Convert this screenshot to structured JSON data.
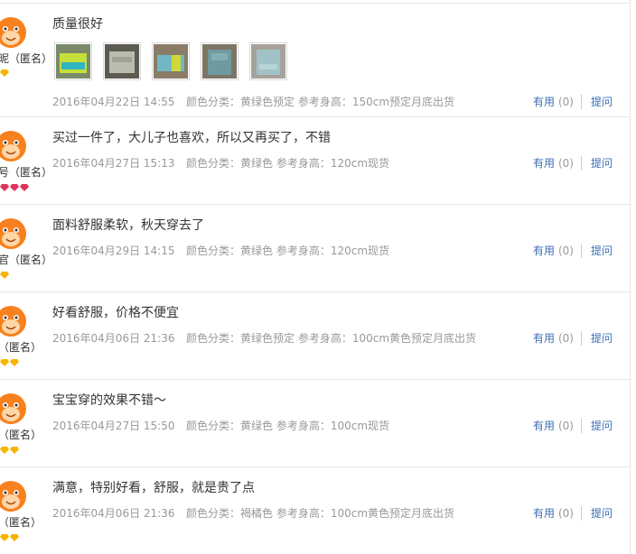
{
  "reviews": [
    {
      "user": "昵（匿名）",
      "gems": 1,
      "gem_color": "#f5b400",
      "content": "质量很好",
      "has_photos": true,
      "photos": [
        {
          "icon": "jacket-photo-icon"
        },
        {
          "icon": "pants-gray-photo-icon"
        },
        {
          "icon": "jacket-folded-photo-icon"
        },
        {
          "icon": "pants-photo-icon"
        },
        {
          "icon": "pants-light-photo-icon"
        }
      ],
      "date": "2016年04月22日 14:55",
      "sku": "颜色分类：黄绿色预定   参考身高：150cm预定月底出货",
      "useful_label": "有用",
      "useful_count": "(0)",
      "ask_label": "提问"
    },
    {
      "user": "号（匿名）",
      "gems": 3,
      "gem_color": "#e0325a",
      "content": "买过一件了，大儿子也喜欢，所以又再买了，不错",
      "has_photos": false,
      "date": "2016年04月27日 15:13",
      "sku": "颜色分类：黄绿色   参考身高：120cm现货",
      "useful_label": "有用",
      "useful_count": "(0)",
      "ask_label": "提问"
    },
    {
      "user": "官（匿名）",
      "gems": 1,
      "gem_color": "#f5b400",
      "content": "面料舒服柔软，秋天穿去了",
      "has_photos": false,
      "date": "2016年04月29日 14:15",
      "sku": "颜色分类：黄绿色   参考身高：120cm现货",
      "useful_label": "有用",
      "useful_count": "(0)",
      "ask_label": "提问"
    },
    {
      "user": "（匿名）",
      "gems": 2,
      "gem_color": "#f5b400",
      "content": "好看舒服，价格不便宜",
      "has_photos": false,
      "date": "2016年04月06日 21:36",
      "sku": "颜色分类：黄绿色预定   参考身高：100cm黄色预定月底出货",
      "useful_label": "有用",
      "useful_count": "(0)",
      "ask_label": "提问"
    },
    {
      "user": "（匿名）",
      "gems": 2,
      "gem_color": "#f5b400",
      "content": "宝宝穿的效果不错～",
      "has_photos": false,
      "date": "2016年04月27日 15:50",
      "sku": "颜色分类：黄绿色   参考身高：100cm现货",
      "useful_label": "有用",
      "useful_count": "(0)",
      "ask_label": "提问"
    },
    {
      "user": "（匿名）",
      "gems": 2,
      "gem_color": "#f5b400",
      "content": "满意，特别好看，舒服，就是贵了点",
      "has_photos": false,
      "date": "2016年04月06日 21:36",
      "sku": "颜色分类：褐橘色   参考身高：100cm黄色预定月底出货",
      "useful_label": "有用",
      "useful_count": "(0)",
      "ask_label": "提问"
    }
  ]
}
